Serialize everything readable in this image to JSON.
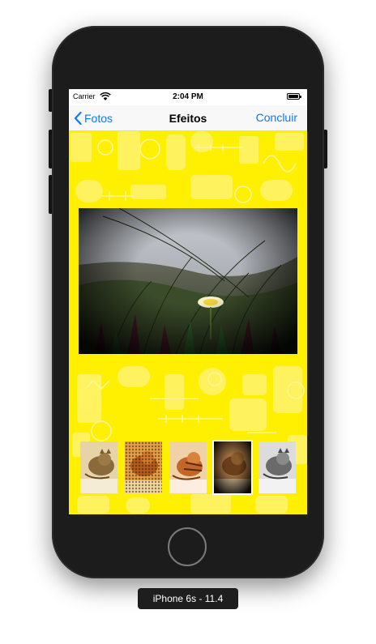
{
  "status_bar": {
    "carrier": "Carrier",
    "time": "2:04 PM",
    "wifi_icon": "wifi-icon",
    "battery_icon": "battery-icon"
  },
  "nav": {
    "back_label": "Fotos",
    "back_icon": "chevron-left-icon",
    "title": "Efeitos",
    "done_label": "Concluir",
    "tint_color": "#0a7aff"
  },
  "content": {
    "background_color": "#ffef00",
    "main_photo": "vignette-effect-photo",
    "filters": [
      {
        "name": "sepia-cat",
        "selected": false
      },
      {
        "name": "halftone-cat",
        "selected": false
      },
      {
        "name": "posterize-cat",
        "selected": false
      },
      {
        "name": "vignette-cat",
        "selected": true
      },
      {
        "name": "mono-cat",
        "selected": false
      }
    ]
  },
  "simulator_label": "iPhone 6s - 11.4"
}
